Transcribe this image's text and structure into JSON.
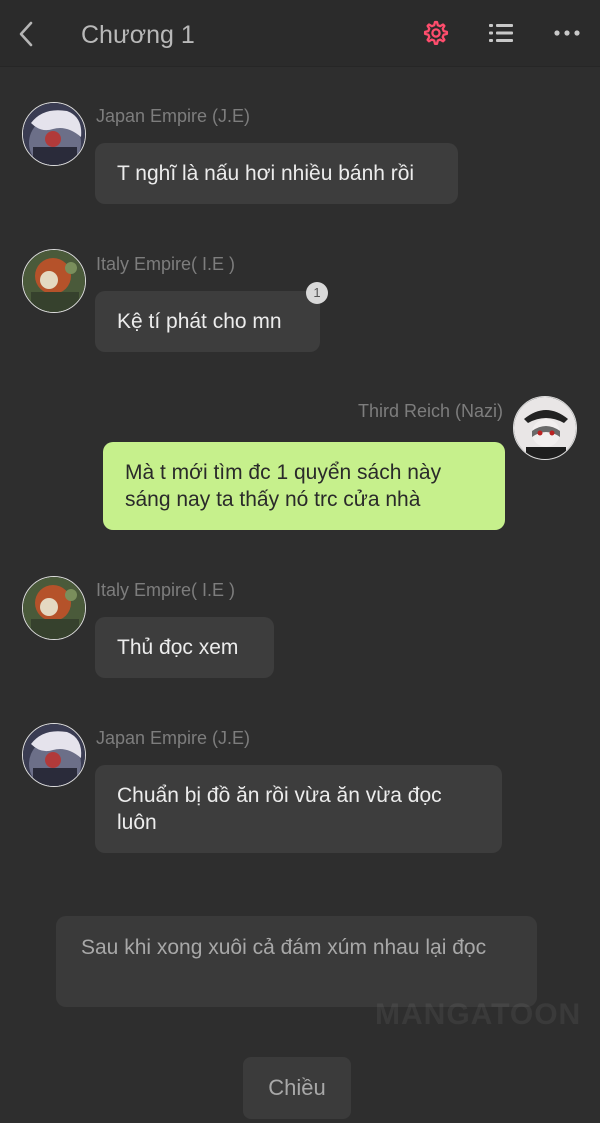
{
  "header": {
    "title": "Chương 1",
    "back_icon": "chevron-left-icon",
    "settings_icon": "gear-icon",
    "list_icon": "list-icon",
    "more_icon": "more-horizontal-icon",
    "settings_color": "#ff4d6d"
  },
  "messages": [
    {
      "sender": "Japan Empire (J.E)",
      "text": "T nghĩ là nấu hơi nhiều bánh rồi",
      "side": "left"
    },
    {
      "sender": "Italy Empire( I.E )",
      "text": "Kệ tí phát cho mn",
      "side": "left",
      "badge": "1"
    },
    {
      "sender": "Third Reich (Nazi)",
      "text": "Mà t mới tìm đc 1 quyển sách này sáng nay ta thấy nó trc cửa nhà",
      "side": "right",
      "color": "#c6f08c"
    },
    {
      "sender": "Italy Empire( I.E )",
      "text": "Thủ đọc xem",
      "side": "left"
    },
    {
      "sender": "Japan Empire (J.E)",
      "text": "Chuẩn bị đồ ăn rồi vừa ăn vừa đọc luôn",
      "side": "left"
    }
  ],
  "narration": "Sau khi xong xuôi cả đám xúm nhau lại đọc",
  "watermark": "MANGATOON",
  "footer": {
    "next_label": "Chiều"
  }
}
